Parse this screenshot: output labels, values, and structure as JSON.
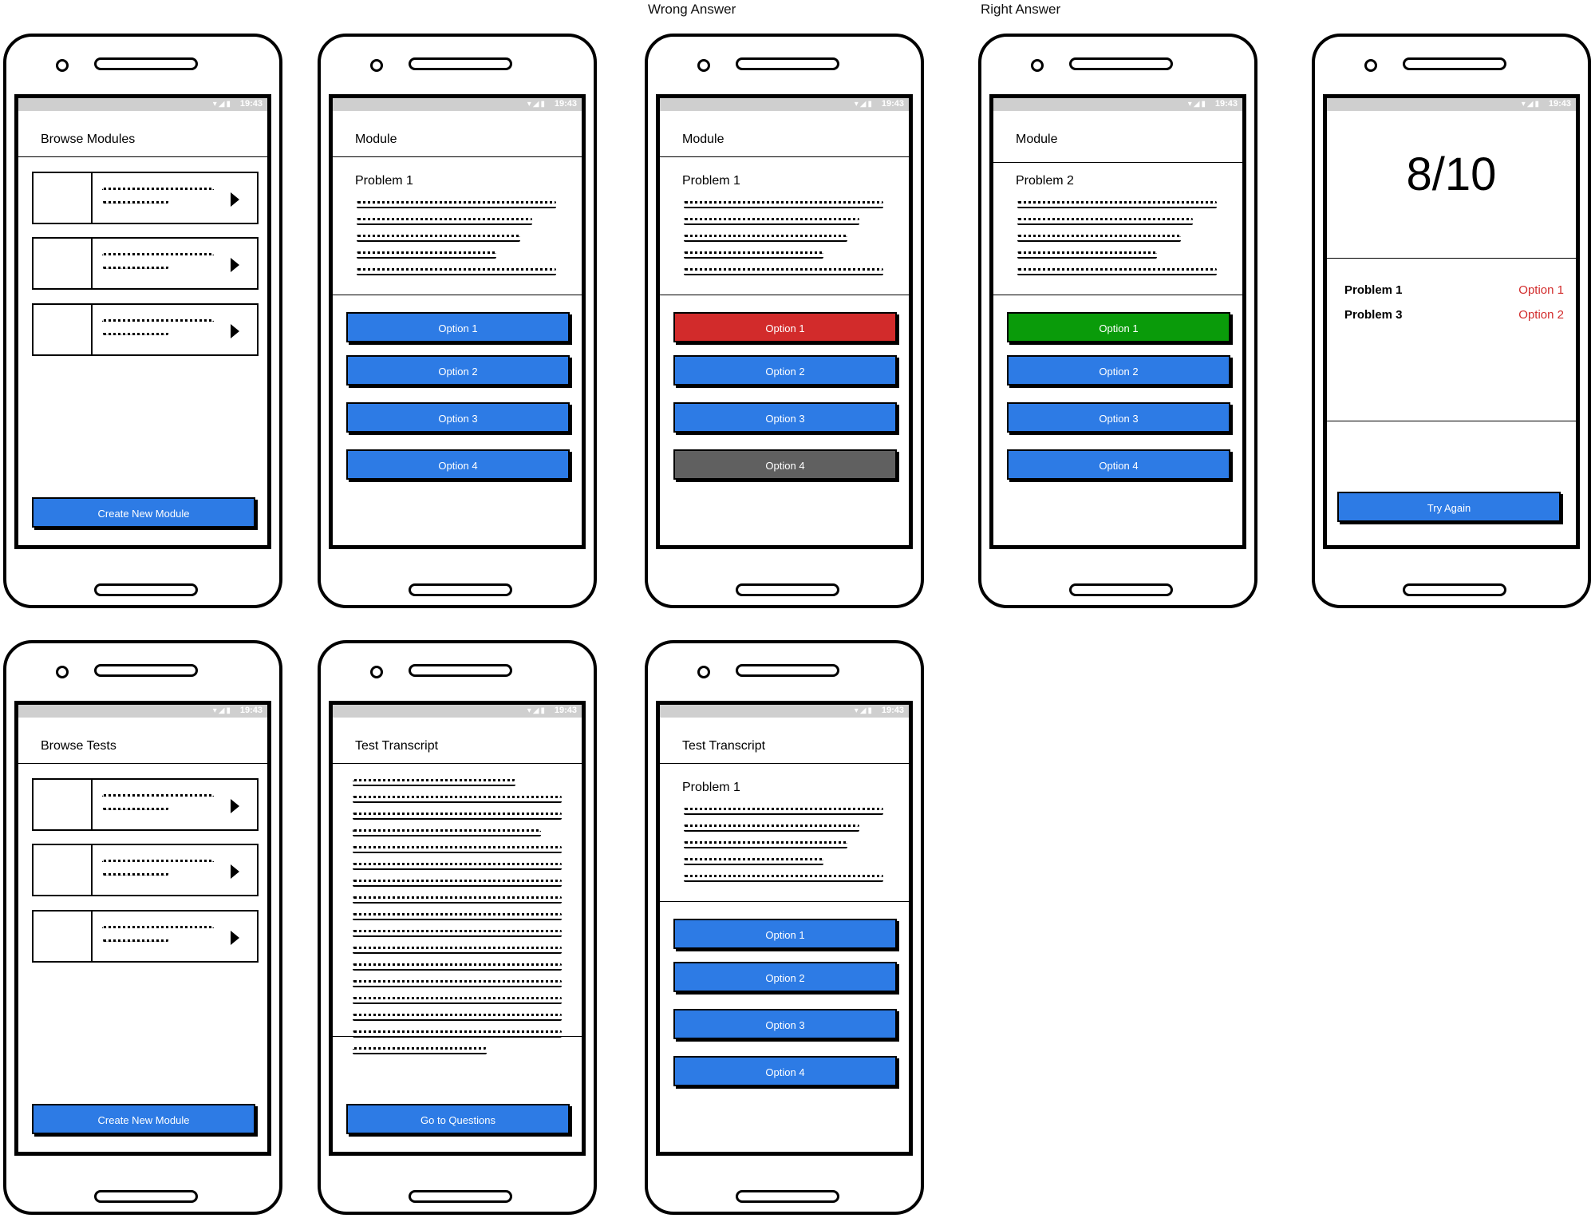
{
  "captions": {
    "wrong": "Wrong Answer",
    "right": "Right Answer"
  },
  "status": {
    "time": "19:43",
    "icons": "▾◢▮"
  },
  "screens": {
    "browse_modules": {
      "title": "Browse Modules",
      "button": "Create New Module"
    },
    "module1": {
      "title": "Module",
      "problem": "Problem 1",
      "options": [
        "Option 1",
        "Option 2",
        "Option 3",
        "Option 4"
      ]
    },
    "wrong": {
      "title": "Module",
      "problem": "Problem 1",
      "options": [
        "Option 1",
        "Option 2",
        "Option 3",
        "Option 4"
      ]
    },
    "right": {
      "title": "Module",
      "problem": "Problem 2",
      "options": [
        "Option 1",
        "Option 2",
        "Option 3",
        "Option 4"
      ]
    },
    "results": {
      "score": "8/10",
      "rows": [
        {
          "problem": "Problem 1",
          "answer": "Option 1"
        },
        {
          "problem": "Problem 3",
          "answer": "Option 2"
        }
      ],
      "button": "Try Again"
    },
    "browse_tests": {
      "title": "Browse Tests",
      "button": "Create New Module"
    },
    "transcript": {
      "title": "Test Transcript",
      "button": "Go to Questions"
    },
    "transcript_q": {
      "title": "Test Transcript",
      "problem": "Problem 1",
      "options": [
        "Option 1",
        "Option 2",
        "Option 3",
        "Option 4"
      ]
    }
  },
  "colors": {
    "primary": "#2d7be5",
    "wrong": "#d22b2b",
    "correct": "#0a9b0a",
    "disabled": "#606060"
  }
}
